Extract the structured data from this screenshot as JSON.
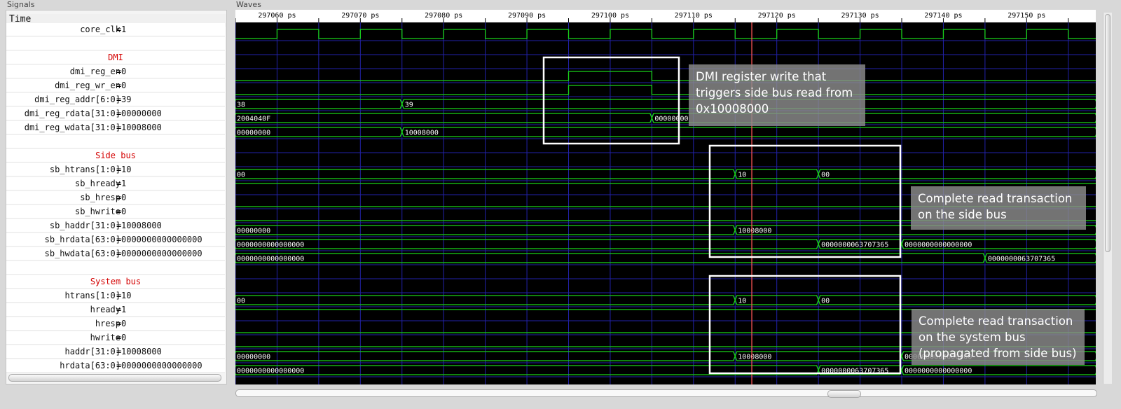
{
  "panes": {
    "signals_title": "Signals",
    "waves_title": "Waves"
  },
  "time_header": "Time",
  "time_axis": {
    "unit": "ps",
    "start": 297055,
    "end": 297158.3,
    "ticks": [
      {
        "t": 297060,
        "label": "297060 ps"
      },
      {
        "t": 297070,
        "label": "297070 ps"
      },
      {
        "t": 297080,
        "label": "297080 ps"
      },
      {
        "t": 297090,
        "label": "297090 ps"
      },
      {
        "t": 297100,
        "label": "297100 ps"
      },
      {
        "t": 297110,
        "label": "297110 ps"
      },
      {
        "t": 297120,
        "label": "297120 ps"
      },
      {
        "t": 297130,
        "label": "297130 ps"
      },
      {
        "t": 297140,
        "label": "297140 ps"
      },
      {
        "t": 297150,
        "label": "297150 ps"
      }
    ]
  },
  "cursor_time": 297117,
  "colors": {
    "wave": "#19d219",
    "grid": "#2222aa",
    "cursor": "#ff5555",
    "background": "#000000",
    "group": "#d40000"
  },
  "signals": [
    {
      "type": "signal",
      "name": "core_clk",
      "value": "1",
      "wave": {
        "kind": "clock",
        "first_edge": 297055,
        "half_period": 5
      }
    },
    {
      "type": "blank"
    },
    {
      "type": "group",
      "name": "DMI"
    },
    {
      "type": "signal",
      "name": "dmi_reg_en",
      "value": "0",
      "wave": {
        "kind": "bit",
        "segments": [
          [
            297055,
            0
          ],
          [
            297095,
            1
          ],
          [
            297105,
            0
          ]
        ]
      }
    },
    {
      "type": "signal",
      "name": "dmi_reg_wr_en",
      "value": "0",
      "wave": {
        "kind": "bit",
        "segments": [
          [
            297055,
            0
          ],
          [
            297095,
            1
          ],
          [
            297105,
            0
          ]
        ]
      }
    },
    {
      "type": "signal",
      "name": "dmi_reg_addr[6:0]",
      "value": "39",
      "wave": {
        "kind": "bus",
        "segments": [
          [
            297055,
            "38"
          ],
          [
            297075,
            "39"
          ]
        ]
      }
    },
    {
      "type": "signal",
      "name": "dmi_reg_rdata[31:0]",
      "value": "00000000",
      "wave": {
        "kind": "bus",
        "segments": [
          [
            297055,
            "2004040F"
          ],
          [
            297105,
            "00000000"
          ]
        ]
      }
    },
    {
      "type": "signal",
      "name": "dmi_reg_wdata[31:0]",
      "value": "10008000",
      "wave": {
        "kind": "bus",
        "segments": [
          [
            297055,
            "00000000"
          ],
          [
            297075,
            "10008000"
          ]
        ]
      }
    },
    {
      "type": "blank"
    },
    {
      "type": "group",
      "name": "Side bus"
    },
    {
      "type": "signal",
      "name": "sb_htrans[1:0]",
      "value": "10",
      "wave": {
        "kind": "bus",
        "segments": [
          [
            297055,
            "00"
          ],
          [
            297115,
            "10"
          ],
          [
            297125,
            "00"
          ]
        ]
      }
    },
    {
      "type": "signal",
      "name": "sb_hready",
      "value": "1",
      "wave": {
        "kind": "bit",
        "segments": [
          [
            297055,
            1
          ]
        ]
      }
    },
    {
      "type": "signal",
      "name": "sb_hresp",
      "value": "0",
      "wave": {
        "kind": "bit",
        "segments": [
          [
            297055,
            0
          ]
        ]
      }
    },
    {
      "type": "signal",
      "name": "sb_hwrite",
      "value": "0",
      "wave": {
        "kind": "bit",
        "segments": [
          [
            297055,
            0
          ]
        ]
      }
    },
    {
      "type": "signal",
      "name": "sb_haddr[31:0]",
      "value": "10008000",
      "wave": {
        "kind": "bus",
        "segments": [
          [
            297055,
            "00000000"
          ],
          [
            297115,
            "10008000"
          ]
        ]
      }
    },
    {
      "type": "signal",
      "name": "sb_hrdata[63:0]",
      "value": "0000000000000000",
      "wave": {
        "kind": "bus",
        "segments": [
          [
            297055,
            "0000000000000000"
          ],
          [
            297125,
            "0000000063707365"
          ],
          [
            297135,
            "0000000000000000"
          ]
        ]
      }
    },
    {
      "type": "signal",
      "name": "sb_hwdata[63:0]",
      "value": "0000000000000000",
      "wave": {
        "kind": "bus",
        "segments": [
          [
            297055,
            "0000000000000000"
          ],
          [
            297145,
            "0000000063707365"
          ]
        ]
      }
    },
    {
      "type": "blank"
    },
    {
      "type": "group",
      "name": "System bus"
    },
    {
      "type": "signal",
      "name": "htrans[1:0]",
      "value": "10",
      "wave": {
        "kind": "bus",
        "segments": [
          [
            297055,
            "00"
          ],
          [
            297115,
            "10"
          ],
          [
            297125,
            "00"
          ]
        ]
      }
    },
    {
      "type": "signal",
      "name": "hready",
      "value": "1",
      "wave": {
        "kind": "bit",
        "segments": [
          [
            297055,
            1
          ]
        ]
      }
    },
    {
      "type": "signal",
      "name": "hresp",
      "value": "0",
      "wave": {
        "kind": "bit",
        "segments": [
          [
            297055,
            0
          ]
        ]
      }
    },
    {
      "type": "signal",
      "name": "hwrite",
      "value": "0",
      "wave": {
        "kind": "bit",
        "segments": [
          [
            297055,
            0
          ]
        ]
      }
    },
    {
      "type": "signal",
      "name": "haddr[31:0]",
      "value": "10008000",
      "wave": {
        "kind": "bus",
        "segments": [
          [
            297055,
            "00000000"
          ],
          [
            297115,
            "10008000"
          ],
          [
            297135,
            "0000000000000000"
          ]
        ]
      }
    },
    {
      "type": "signal",
      "name": "hrdata[63:0]",
      "value": "0000000000000000",
      "wave": {
        "kind": "bus",
        "segments": [
          [
            297055,
            "0000000000000000"
          ],
          [
            297125,
            "0000000063707365"
          ],
          [
            297135,
            "0000000000000000"
          ]
        ]
      }
    }
  ],
  "annotations": [
    {
      "id": "dmi-write",
      "lines": [
        "DMI register write that",
        "triggers side bus read from",
        "0x10008000"
      ]
    },
    {
      "id": "side-bus-read",
      "lines": [
        "Complete read transaction",
        "on the side bus"
      ]
    },
    {
      "id": "system-bus-read",
      "lines": [
        "Complete read transaction",
        "on the system bus",
        "(propagated from side bus)"
      ]
    }
  ]
}
